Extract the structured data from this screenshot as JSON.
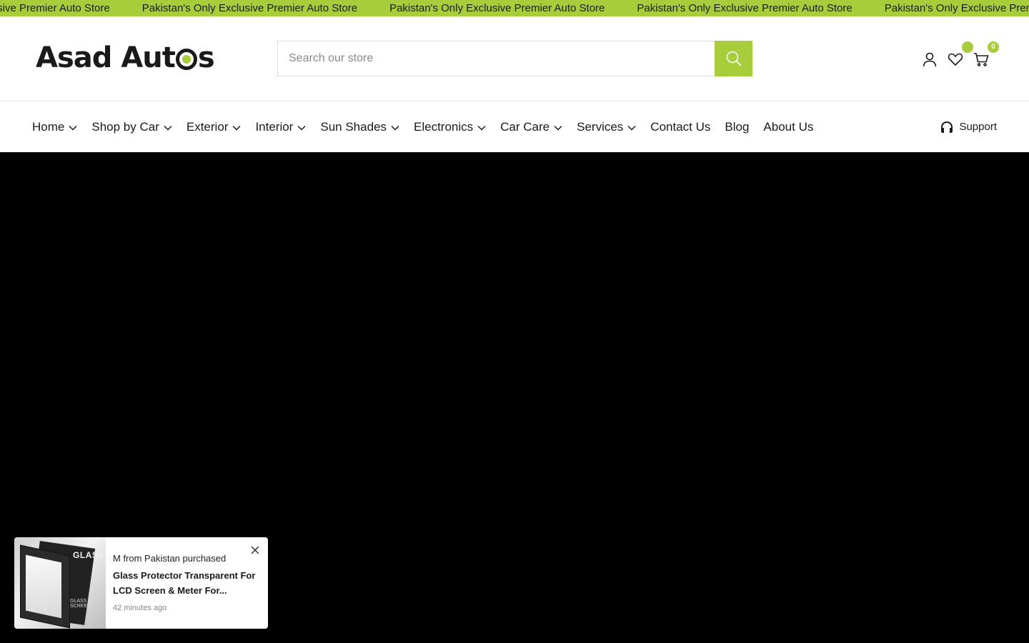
{
  "announcement": {
    "items": [
      "clusive Premier Auto Store",
      "Pakistan's Only Exclusive Premier Auto Store",
      "Pakistan's Only Exclusive Premier Auto Store",
      "Pakistan's Only Exclusive Premier Auto Store",
      "Pakistan's Only Exclusive Premier Auto Store"
    ]
  },
  "header": {
    "logo_part1": "Asad Aut",
    "logo_part2": "s",
    "search_placeholder": "Search our store",
    "icons": [
      "user-icon",
      "heart-icon",
      "cart-icon"
    ],
    "cart_count": "0"
  },
  "nav": {
    "items": [
      {
        "label": "Home",
        "dropdown": true
      },
      {
        "label": "Shop by Car",
        "dropdown": true
      },
      {
        "label": "Exterior",
        "dropdown": true
      },
      {
        "label": "Interior",
        "dropdown": true
      },
      {
        "label": "Sun Shades",
        "dropdown": true
      },
      {
        "label": "Electronics",
        "dropdown": true
      },
      {
        "label": "Car Care",
        "dropdown": true
      },
      {
        "label": "Services",
        "dropdown": true
      },
      {
        "label": "Contact Us",
        "dropdown": false
      },
      {
        "label": "Blog",
        "dropdown": false
      },
      {
        "label": "About Us",
        "dropdown": false
      }
    ],
    "support_label": "Support"
  },
  "popup": {
    "line1": "M from Pakistan purchased",
    "product": "Glass Protector Transparent For LCD Screen & Meter For...",
    "time": "42 minutes ago",
    "image_label": "GLASS",
    "image_sublabel": "GLASS SCREEN"
  },
  "colors": {
    "accent": "#a8cd3a",
    "hero_bg": "#000000"
  }
}
